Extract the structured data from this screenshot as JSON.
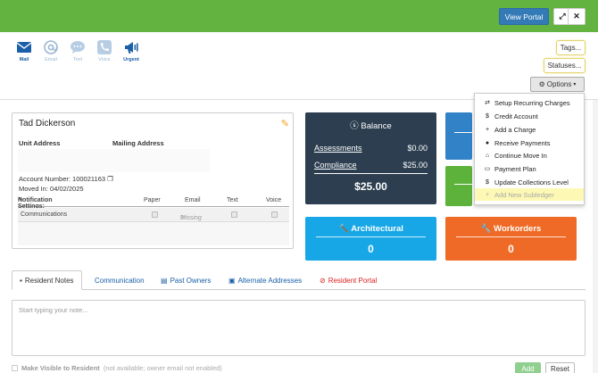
{
  "header": {
    "view_portal_label": "View Portal",
    "expand_glyph": "⤢",
    "close_glyph": "✕"
  },
  "comm": [
    {
      "label": "Mail",
      "icon": "mail-icon",
      "active": true
    },
    {
      "label": "Email",
      "icon": "email-icon",
      "active": false
    },
    {
      "label": "Text",
      "icon": "text-icon",
      "active": false
    },
    {
      "label": "Voice",
      "icon": "voice-icon",
      "active": false
    },
    {
      "label": "Urgent",
      "icon": "urgent-icon",
      "active": true
    }
  ],
  "right_buttons": {
    "tags": "Tags...",
    "statuses": "Statuses...",
    "options": "Options"
  },
  "options_menu": [
    {
      "icon": "⇄",
      "label": "Setup Recurring Charges"
    },
    {
      "icon": "$",
      "label": "Credit Account"
    },
    {
      "icon": "+",
      "label": "Add a Charge"
    },
    {
      "icon": "●",
      "label": "Receive Payments"
    },
    {
      "icon": "⌂",
      "label": "Continue Move In"
    },
    {
      "icon": "▭",
      "label": "Payment Plan"
    },
    {
      "icon": "$",
      "label": "Update Collections Level"
    },
    {
      "icon": "+",
      "label": "Add New Subledger"
    }
  ],
  "profile": {
    "name": "Tad Dickerson",
    "unit_address_label": "Unit Address",
    "mailing_address_label": "Mailing Address",
    "account_number_label": "Account Number:",
    "account_number": "100021163",
    "moved_in_label": "Moved In:",
    "moved_in": "04/02/2025",
    "notif_settings_label": "Notification Settings:",
    "notif_cols": [
      "Paper",
      "Email",
      "Text",
      "Voice"
    ],
    "notif_row_label": "Communications",
    "notif_email_status": "Missing"
  },
  "balance": {
    "title": "Balance",
    "assessments_label": "Assessments",
    "assessments_value": "$0.00",
    "compliance_label": "Compliance",
    "compliance_value": "$25.00",
    "total": "$25.00"
  },
  "architectural": {
    "title": "Architectural",
    "count": "0"
  },
  "workorders": {
    "title": "Workorders",
    "count": "0"
  },
  "tabs": [
    {
      "label": "Resident Notes"
    },
    {
      "label": "Communication"
    },
    {
      "label": "Past Owners"
    },
    {
      "label": "Alternate Addresses"
    },
    {
      "label": "Resident Portal"
    }
  ],
  "note": {
    "placeholder": "Start typing your note..."
  },
  "footer": {
    "visible_label": "Make Visible to Resident",
    "visible_note": "(not available; owner email not enabled)",
    "add_label": "Add",
    "reset_label": "Reset"
  },
  "colors": {
    "topbar": "#62b33f",
    "primary": "#337ab7",
    "balance_tile": "#2c3e50",
    "arch_tile": "#17a6e6",
    "work_tile": "#ef6a26"
  }
}
